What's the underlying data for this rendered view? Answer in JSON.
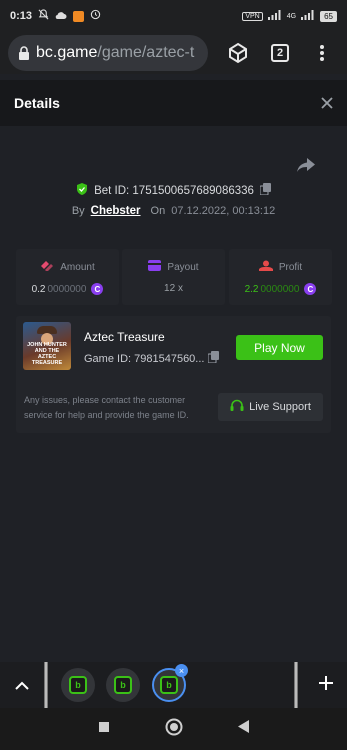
{
  "status_bar": {
    "time": "0:13",
    "vpn": "VPN",
    "network": "4G",
    "battery": "65"
  },
  "browser": {
    "url_host": "bc.game",
    "url_path": "/game/aztec-t",
    "tab_count": "2"
  },
  "details": {
    "title": "Details"
  },
  "bet": {
    "bet_id_label": "Bet ID: 1751500657689086336",
    "by_label": "By",
    "user": "Chebster",
    "on_label": "On",
    "date": "07.12.2022, 00:13:12"
  },
  "stats": {
    "amount_label": "Amount",
    "amount_main": "0.2",
    "amount_zeros": "0000000",
    "payout_label": "Payout",
    "payout_value": "12 x",
    "profit_label": "Profit",
    "profit_main": "2.2",
    "profit_zeros": "0000000",
    "coin_symbol": "C"
  },
  "game": {
    "name": "Aztec Treasure",
    "game_id": "Game ID: 7981547560...",
    "thumb_title": "JOHN HUNTER AND THE AZTEC TREASURE",
    "play_label": "Play Now",
    "issue_text": "Any issues, please contact the customer service for help and provide the game ID.",
    "support_label": "Live Support"
  },
  "colors": {
    "accent_green": "#3bc117",
    "coin_purple": "#8a3ff0",
    "tab_blue": "#4a8ff0"
  },
  "tab_switcher": {
    "tab_letter": "b",
    "badge": "×"
  }
}
